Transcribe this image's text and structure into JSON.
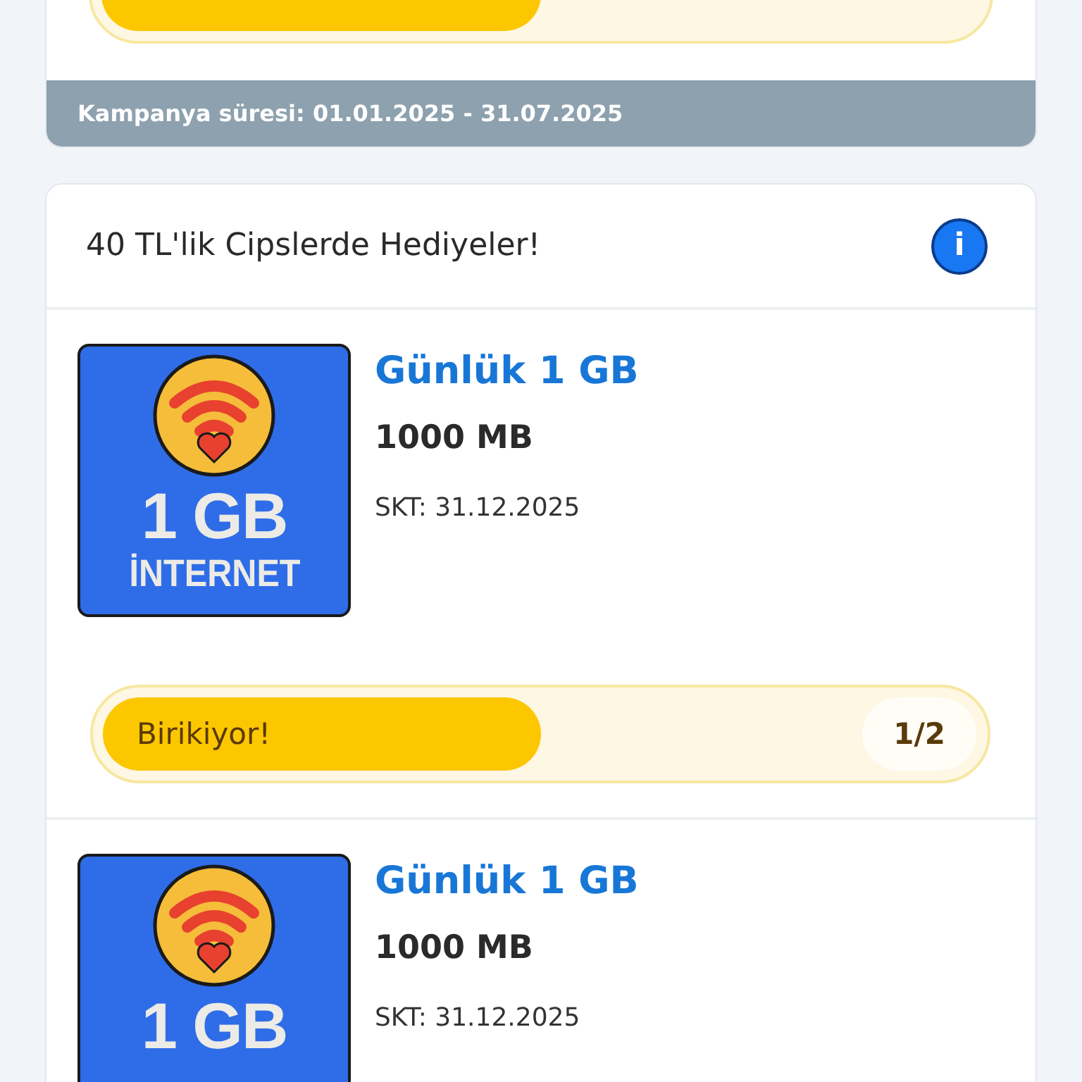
{
  "top_campaign": {
    "progress": {
      "level": 0.5
    },
    "period": "Kampanya süresi: 01.01.2025 - 31.07.2025"
  },
  "campaign": {
    "title": "40 TL'lik Cipslerde Hediyeler!",
    "info_icon": "i",
    "items": [
      {
        "image_lines": [
          "1 GB",
          "İNTERNET"
        ],
        "name": "Günlük 1 GB",
        "amount": "1000 MB",
        "expiry": "SKT: 31.12.2025",
        "progress": {
          "label": "Birikiyor!",
          "count": "1/2",
          "level": 0.5
        }
      },
      {
        "image_lines": [
          "1 GB"
        ],
        "name": "Günlük 1 GB",
        "amount": "1000 MB",
        "expiry": "SKT: 31.12.2025"
      }
    ]
  }
}
